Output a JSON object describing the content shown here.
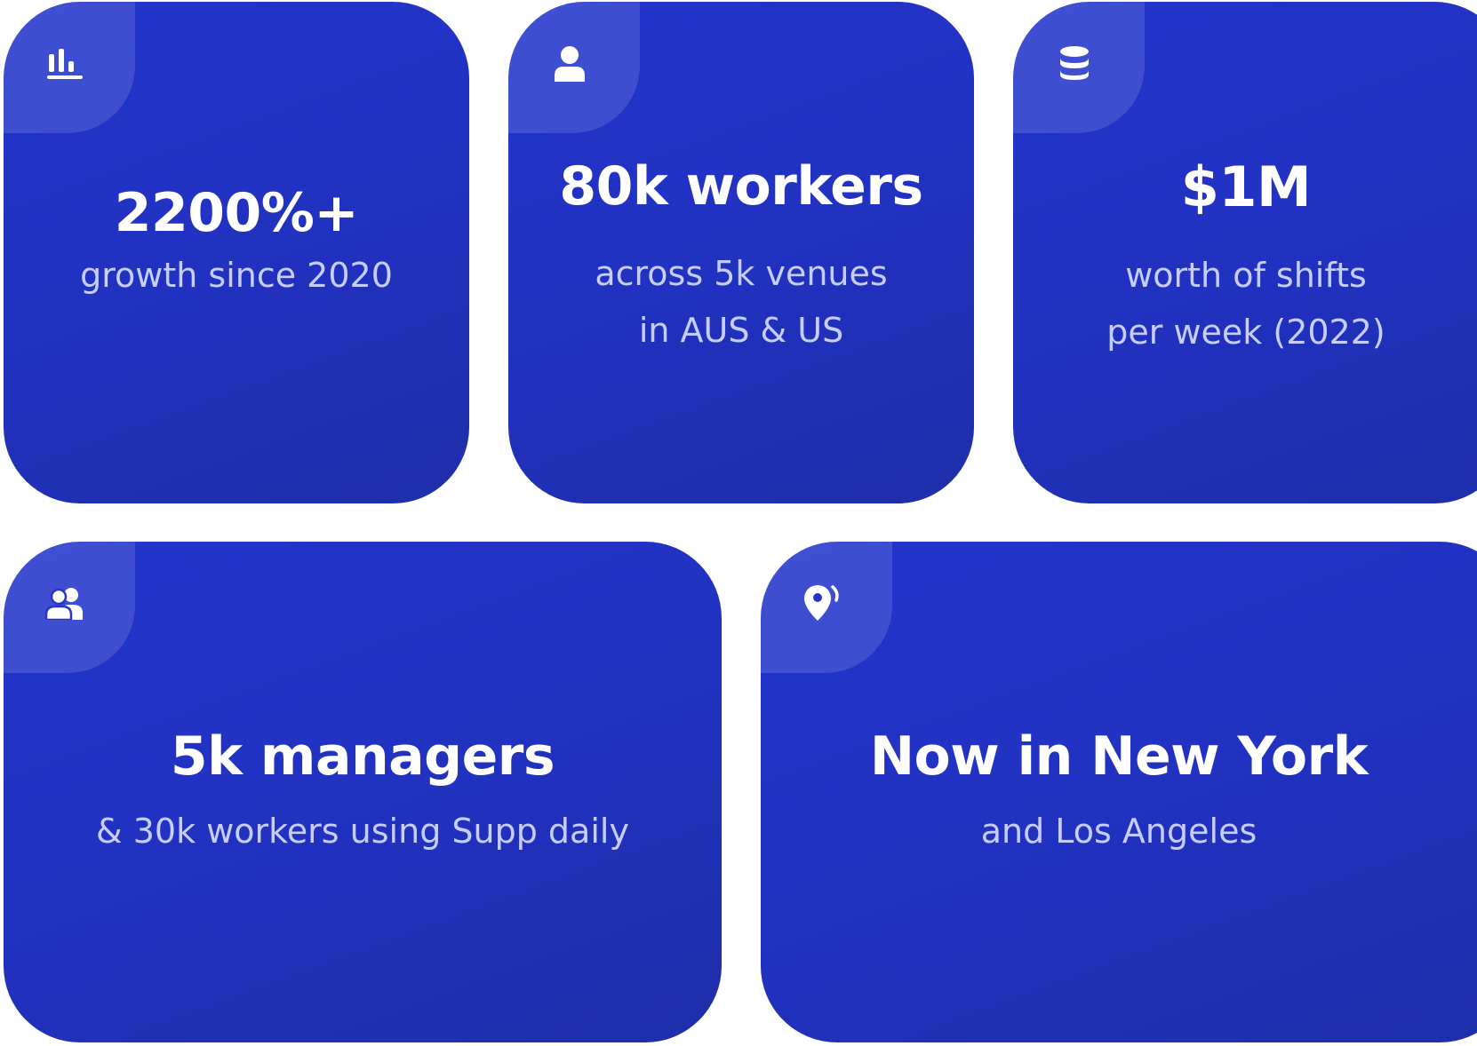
{
  "colors": {
    "card_gradient_start": "#2335cc",
    "card_gradient_end": "#1f2ea8",
    "headline": "#ffffff",
    "subtext": "#c7ceff",
    "background": "#ffffff"
  },
  "cards": [
    {
      "icon": "bar-chart-icon",
      "headline": "2200%+",
      "lines": [
        "growth since 2020"
      ]
    },
    {
      "icon": "user-icon",
      "headline": "80k workers",
      "lines": [
        "across 5k venues",
        "in AUS & US"
      ]
    },
    {
      "icon": "coins-stack-icon",
      "headline": "$1M",
      "lines": [
        "worth of shifts",
        "per week (2022)"
      ]
    },
    {
      "icon": "users-icon",
      "headline": "5k managers",
      "lines": [
        "& 30k workers using Supp daily"
      ]
    },
    {
      "icon": "location-pin-icon",
      "headline": "Now in New York",
      "lines": [
        "and Los Angeles"
      ]
    }
  ]
}
